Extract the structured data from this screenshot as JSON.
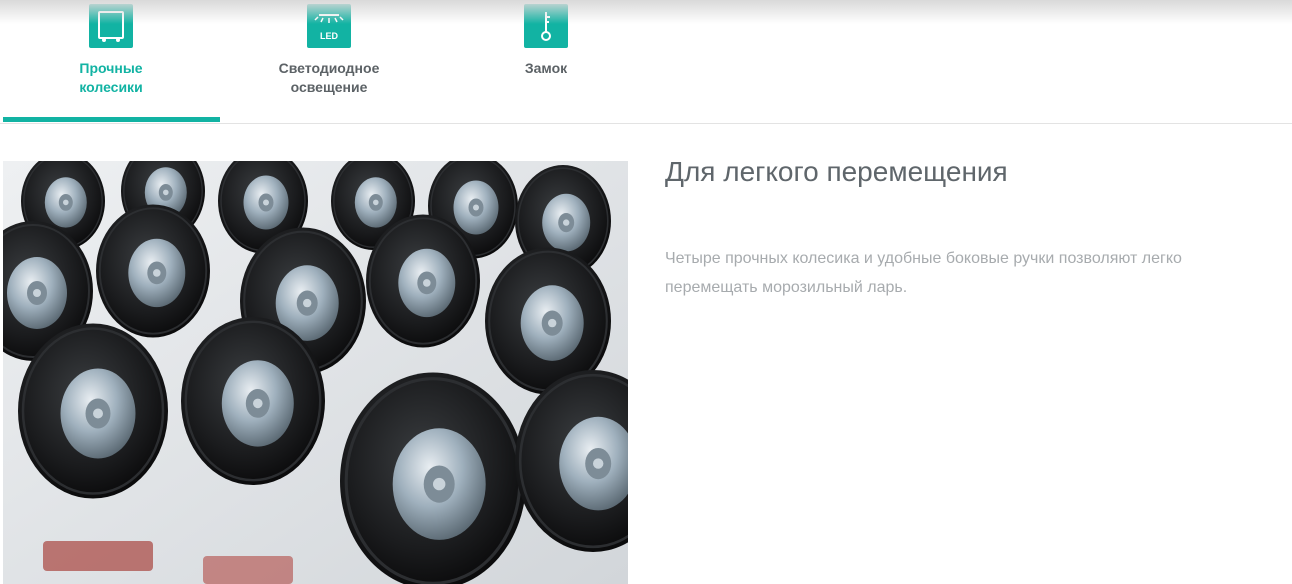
{
  "tabs": [
    {
      "label": "Прочные\nколесики",
      "icon": "wheel-icon",
      "active": true
    },
    {
      "label": "Светодиодное\nосвещение",
      "icon": "led-icon",
      "icon_text": "LED",
      "active": false
    },
    {
      "label": "Замок",
      "icon": "key-icon",
      "active": false
    }
  ],
  "feature": {
    "title": "Для легкого перемещения",
    "description": "Четыре прочных колесика и удобные боковые ручки позволяют легко перемещать морозильный ларь."
  },
  "colors": {
    "accent": "#12b3a3",
    "tab_text": "#5c6266",
    "title": "#5f666b",
    "description": "#a7abae"
  }
}
